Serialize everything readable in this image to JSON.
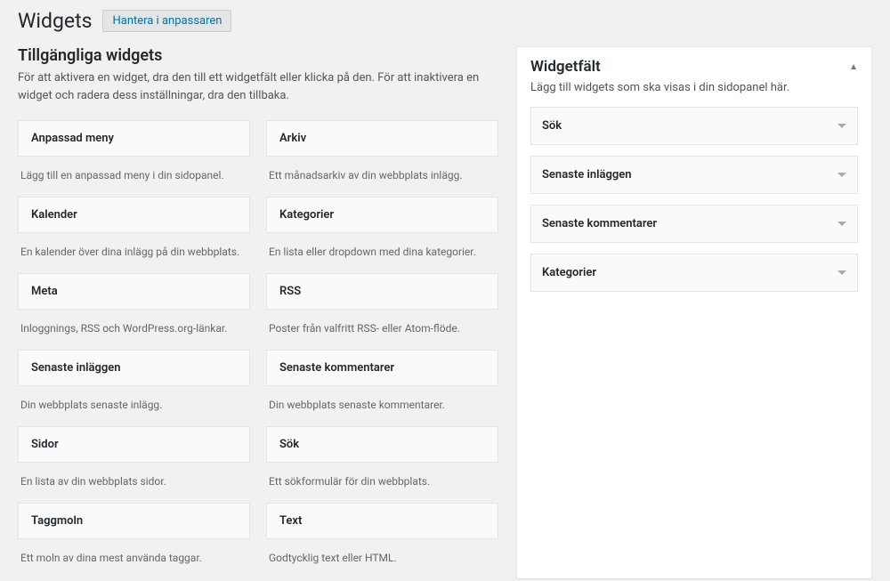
{
  "header": {
    "title": "Widgets",
    "action": "Hantera i anpassaren"
  },
  "available": {
    "title": "Tillgängliga widgets",
    "description": "För att aktivera en widget, dra den till ett widgetfält eller klicka på den. För att inaktivera en widget och radera dess inställningar, dra den tillbaka.",
    "widgets": [
      {
        "title": "Anpassad meny",
        "desc": "Lägg till en anpassad meny i din sidopanel."
      },
      {
        "title": "Arkiv",
        "desc": "Ett månadsarkiv av din webbplats inlägg."
      },
      {
        "title": "Kalender",
        "desc": "En kalender över dina inlägg på din webbplats."
      },
      {
        "title": "Kategorier",
        "desc": "En lista eller dropdown med dina kategorier."
      },
      {
        "title": "Meta",
        "desc": "Inloggnings, RSS och WordPress.org-länkar."
      },
      {
        "title": "RSS",
        "desc": "Poster från valfritt RSS- eller Atom-flöde."
      },
      {
        "title": "Senaste inläggen",
        "desc": "Din webbplats senaste inlägg."
      },
      {
        "title": "Senaste kommentarer",
        "desc": "Din webbplats senaste kommentarer."
      },
      {
        "title": "Sidor",
        "desc": "En lista av din webbplats sidor."
      },
      {
        "title": "Sök",
        "desc": "Ett sökformulär för din webbplats."
      },
      {
        "title": "Taggmoln",
        "desc": "Ett moln av dina mest använda taggar."
      },
      {
        "title": "Text",
        "desc": "Godtycklig text eller HTML."
      }
    ]
  },
  "sidebar": {
    "title": "Widgetfält",
    "description": "Lägg till widgets som ska visas i din sidopanel här.",
    "items": [
      {
        "title": "Sök"
      },
      {
        "title": "Senaste inläggen"
      },
      {
        "title": "Senaste kommentarer"
      },
      {
        "title": "Kategorier"
      }
    ]
  }
}
